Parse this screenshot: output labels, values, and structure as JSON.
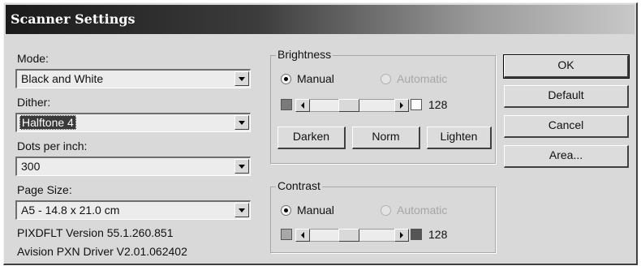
{
  "window": {
    "title": "Scanner Settings"
  },
  "left": {
    "mode": {
      "label": "Mode:",
      "value": "Black and White"
    },
    "dither": {
      "label": "Dither:",
      "value": "Halftone 4"
    },
    "dpi": {
      "label": "Dots per inch:",
      "value": "300"
    },
    "page_size": {
      "label": "Page Size:",
      "value": "A5 - 14.8 x 21.0 cm"
    },
    "version_line1": "PIXDFLT Version 55.1.260.851",
    "version_line2": "Avision PXN Driver V2.01.062402"
  },
  "brightness": {
    "legend": "Brightness",
    "manual_label": "Manual",
    "automatic_label": "Automatic",
    "selected": "manual",
    "value": "128",
    "level": 0.45,
    "swatch_left_color": "#7a7a7a",
    "swatch_right_color": "#ffffff",
    "darken_label": "Darken",
    "norm_label": "Norm",
    "lighten_label": "Lighten"
  },
  "contrast": {
    "legend": "Contrast",
    "manual_label": "Manual",
    "automatic_label": "Automatic",
    "selected": "manual",
    "value": "128",
    "level": 0.45,
    "swatch_left_color": "#a8a8a8",
    "swatch_right_color": "#555555"
  },
  "buttons": {
    "ok": "OK",
    "default": "Default",
    "cancel": "Cancel",
    "area": "Area..."
  }
}
